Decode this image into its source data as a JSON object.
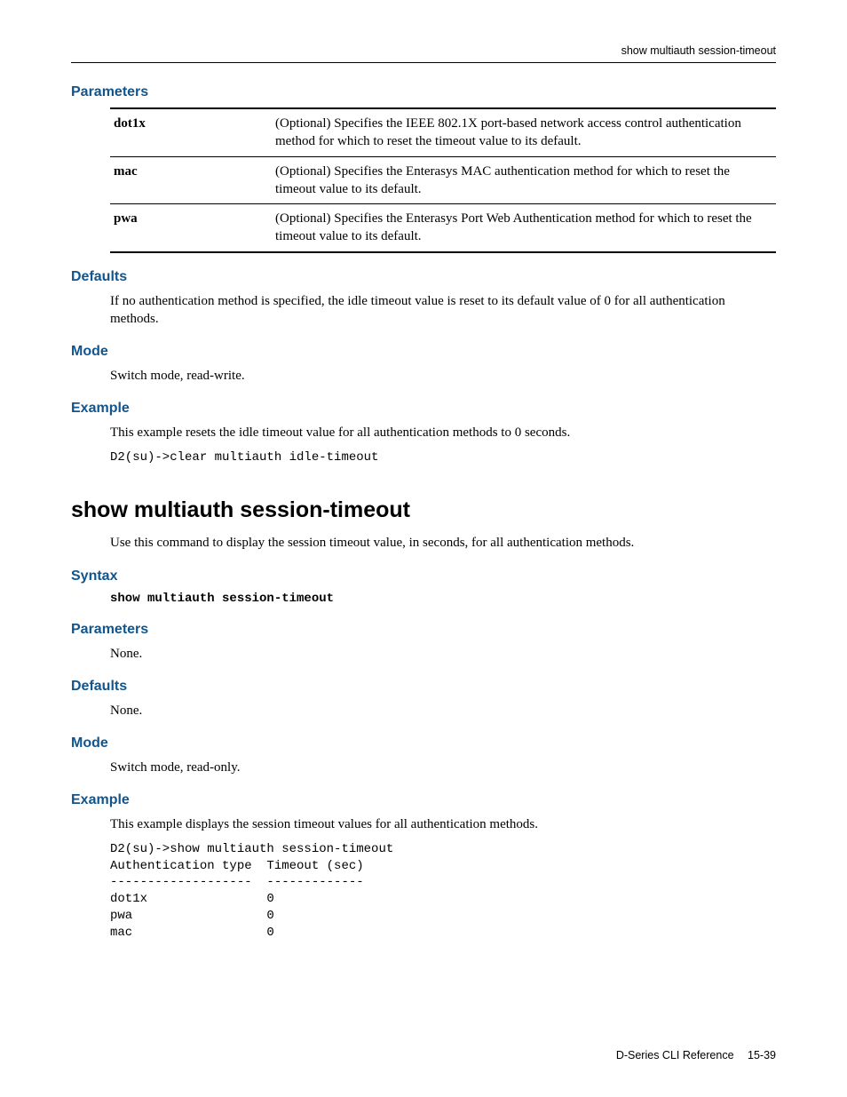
{
  "header": {
    "running_head": "show multiauth session-timeout"
  },
  "section1": {
    "parameters_heading": "Parameters",
    "params": [
      {
        "name": "dot1x",
        "desc": "(Optional) Specifies the IEEE 802.1X port-based network access control authentication method for which to reset the timeout value to its default."
      },
      {
        "name": "mac",
        "desc": "(Optional) Specifies the Enterasys MAC authentication method for which to reset the timeout value to its default."
      },
      {
        "name": "pwa",
        "desc": "(Optional) Specifies the Enterasys Port Web Authentication method for which to reset the timeout value to its default."
      }
    ],
    "defaults_heading": "Defaults",
    "defaults_text": "If no authentication method is specified, the idle timeout value is reset to its default value of 0 for all authentication methods.",
    "mode_heading": "Mode",
    "mode_text": "Switch mode, read-write.",
    "example_heading": "Example",
    "example_text": "This example resets the idle timeout value for all authentication methods to 0 seconds.",
    "example_block": "D2(su)->clear multiauth idle-timeout"
  },
  "section2": {
    "title": "show multiauth session-timeout",
    "intro": "Use this command to display the session timeout value, in seconds, for all authentication methods.",
    "syntax_heading": "Syntax",
    "syntax_block": "show multiauth session-timeout",
    "parameters_heading": "Parameters",
    "parameters_text": "None.",
    "defaults_heading": "Defaults",
    "defaults_text": "None.",
    "mode_heading": "Mode",
    "mode_text": "Switch mode, read-only.",
    "example_heading": "Example",
    "example_text": "This example displays the session timeout values for all authentication methods.",
    "example_block": "D2(su)->show multiauth session-timeout\nAuthentication type  Timeout (sec)\n-------------------  -------------\ndot1x                0\npwa                  0\nmac                  0"
  },
  "footer": {
    "doc": "D-Series CLI Reference",
    "page": "15-39"
  }
}
